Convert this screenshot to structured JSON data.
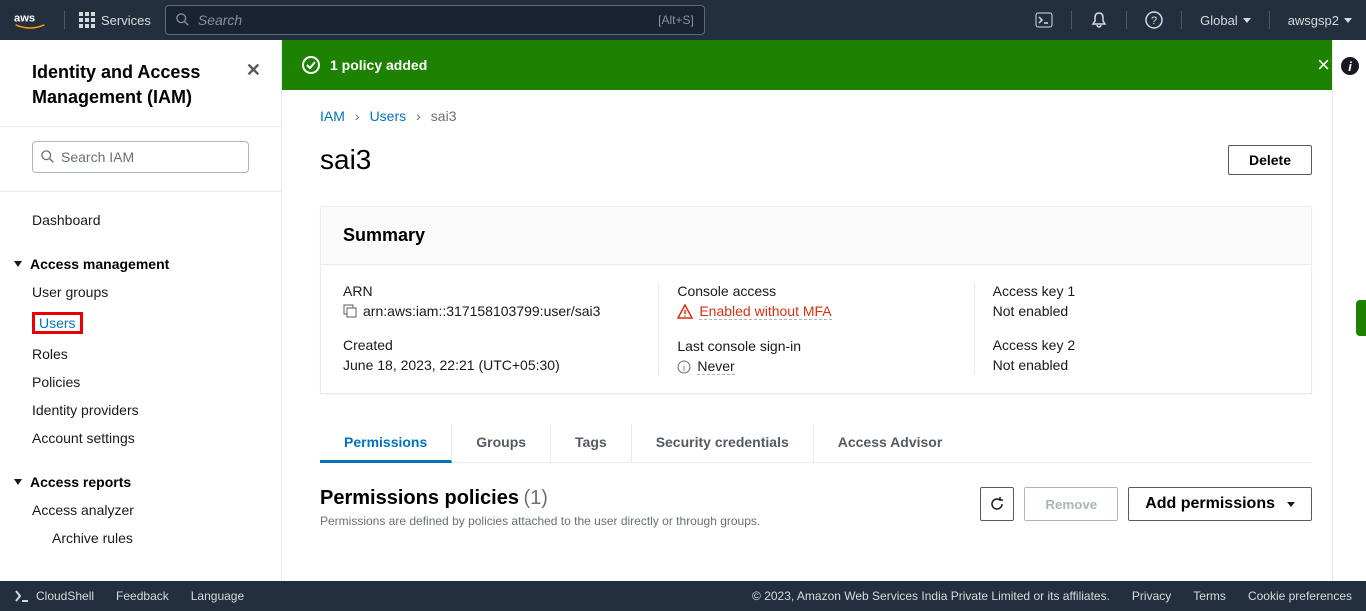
{
  "topnav": {
    "services_label": "Services",
    "search_placeholder": "Search",
    "search_shortcut": "[Alt+S]",
    "region": "Global",
    "account": "awsgsp2"
  },
  "sidebar": {
    "title": "Identity and Access Management (IAM)",
    "search_placeholder": "Search IAM",
    "dashboard": "Dashboard",
    "section_access": "Access management",
    "items_access": [
      "User groups",
      "Users",
      "Roles",
      "Policies",
      "Identity providers",
      "Account settings"
    ],
    "section_reports": "Access reports",
    "items_reports": [
      "Access analyzer",
      "Archive rules"
    ]
  },
  "flash": {
    "message": "1 policy added"
  },
  "breadcrumb": {
    "iam": "IAM",
    "users": "Users",
    "current": "sai3"
  },
  "page": {
    "title": "sai3",
    "delete": "Delete"
  },
  "summary": {
    "heading": "Summary",
    "arn_label": "ARN",
    "arn_value": "arn:aws:iam::317158103799:user/sai3",
    "created_label": "Created",
    "created_value": "June 18, 2023, 22:21 (UTC+05:30)",
    "console_label": "Console access",
    "console_value": "Enabled without MFA",
    "signin_label": "Last console sign-in",
    "signin_value": "Never",
    "key1_label": "Access key 1",
    "key1_value": "Not enabled",
    "key2_label": "Access key 2",
    "key2_value": "Not enabled"
  },
  "tabs": [
    "Permissions",
    "Groups",
    "Tags",
    "Security credentials",
    "Access Advisor"
  ],
  "policies": {
    "title": "Permissions policies",
    "count": "(1)",
    "sub": "Permissions are defined by policies attached to the user directly or through groups.",
    "remove": "Remove",
    "add": "Add permissions"
  },
  "footer": {
    "cloudshell": "CloudShell",
    "feedback": "Feedback",
    "language": "Language",
    "copyright": "© 2023, Amazon Web Services India Private Limited or its affiliates.",
    "privacy": "Privacy",
    "terms": "Terms",
    "cookie": "Cookie preferences"
  }
}
